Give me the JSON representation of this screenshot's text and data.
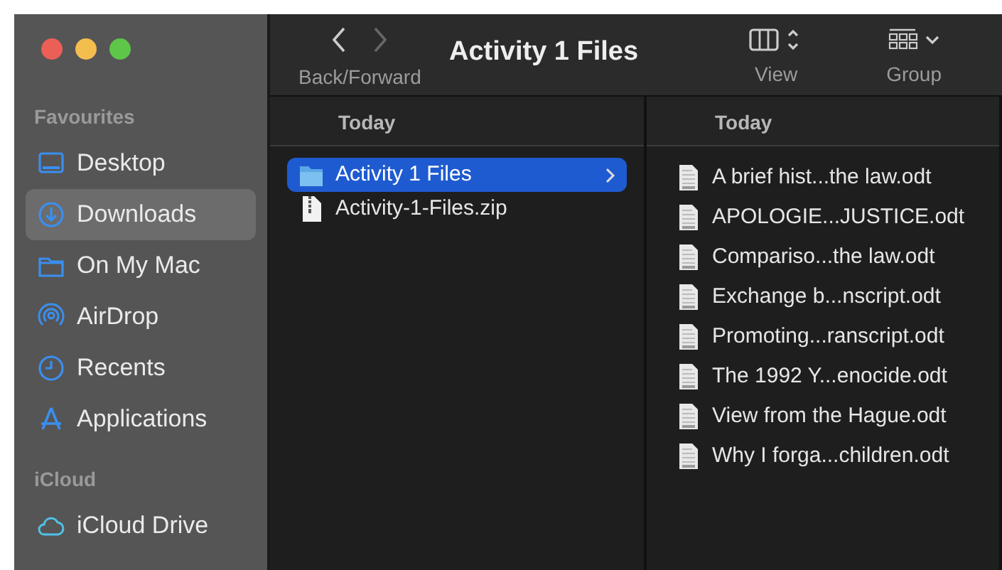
{
  "window": {
    "title": "Activity 1 Files"
  },
  "toolbar": {
    "nav_label": "Back/Forward",
    "view_label": "View",
    "group_label": "Group"
  },
  "sidebar": {
    "sections": [
      {
        "heading": "Favourites",
        "items": [
          {
            "label": "Desktop",
            "kind": "desktop",
            "selected": false
          },
          {
            "label": "Downloads",
            "kind": "downloads",
            "selected": true
          },
          {
            "label": "On My Mac",
            "kind": "folder",
            "selected": false
          },
          {
            "label": "AirDrop",
            "kind": "airdrop",
            "selected": false
          },
          {
            "label": "Recents",
            "kind": "clock",
            "selected": false
          },
          {
            "label": "Applications",
            "kind": "apps",
            "selected": false
          }
        ]
      },
      {
        "heading": "iCloud",
        "items": [
          {
            "label": "iCloud Drive",
            "kind": "cloud",
            "selected": false
          }
        ]
      }
    ]
  },
  "columns": [
    {
      "heading": "Today",
      "items": [
        {
          "name": "Activity 1 Files",
          "kind": "folder",
          "selected": true
        },
        {
          "name": "Activity-1-Files.zip",
          "kind": "zip",
          "selected": false
        }
      ]
    },
    {
      "heading": "Today",
      "items": [
        {
          "name": "A brief hist...the law.odt",
          "kind": "odt",
          "selected": false
        },
        {
          "name": "APOLOGIE...JUSTICE.odt",
          "kind": "odt",
          "selected": false
        },
        {
          "name": "Compariso...the law.odt",
          "kind": "odt",
          "selected": false
        },
        {
          "name": "Exchange b...nscript.odt",
          "kind": "odt",
          "selected": false
        },
        {
          "name": "Promoting...ranscript.odt",
          "kind": "odt",
          "selected": false
        },
        {
          "name": "The 1992 Y...enocide.odt",
          "kind": "odt",
          "selected": false
        },
        {
          "name": "View from the Hague.odt",
          "kind": "odt",
          "selected": false
        },
        {
          "name": "Why I forga...children.odt",
          "kind": "odt",
          "selected": false
        }
      ]
    }
  ]
}
